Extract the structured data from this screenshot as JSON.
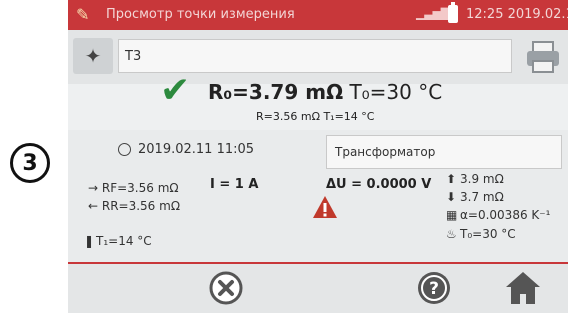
{
  "callout_number": "3",
  "statusbar": {
    "title": "Просмотр точки измерения",
    "time": "12:25 2019.02.11"
  },
  "point": {
    "name": "T3"
  },
  "result": {
    "main_resistance": "R₀=3.79 mΩ",
    "main_temperature": "T₀=30 °C",
    "measured": "R=3.56 mΩ T₁=14 °C"
  },
  "info": {
    "datetime": "2019.02.11 11:05",
    "object": "Трансформатор"
  },
  "details": {
    "rf": "→ RF=3.56 mΩ",
    "rr": "← RR=3.56 mΩ",
    "current": "I = 1 A",
    "voltage": "ΔU = 0.0000 V",
    "upper_limit": "3.9 mΩ",
    "lower_limit": "3.7 mΩ",
    "alpha": "α=0.00386 K⁻¹",
    "t0": "T₀=30 °C",
    "t1": "T₁=14 °C"
  },
  "icons": {
    "app": "electrode-icon",
    "probe": "probe-icon",
    "print": "printer-icon",
    "ok": "checkmark-icon",
    "warning": "warning-triangle-icon",
    "cancel": "cancel-icon",
    "help": "help-icon",
    "home": "home-icon"
  },
  "colors": {
    "accent": "#c8373a",
    "ok": "#2c8a3e",
    "background": "#e9ebec"
  }
}
